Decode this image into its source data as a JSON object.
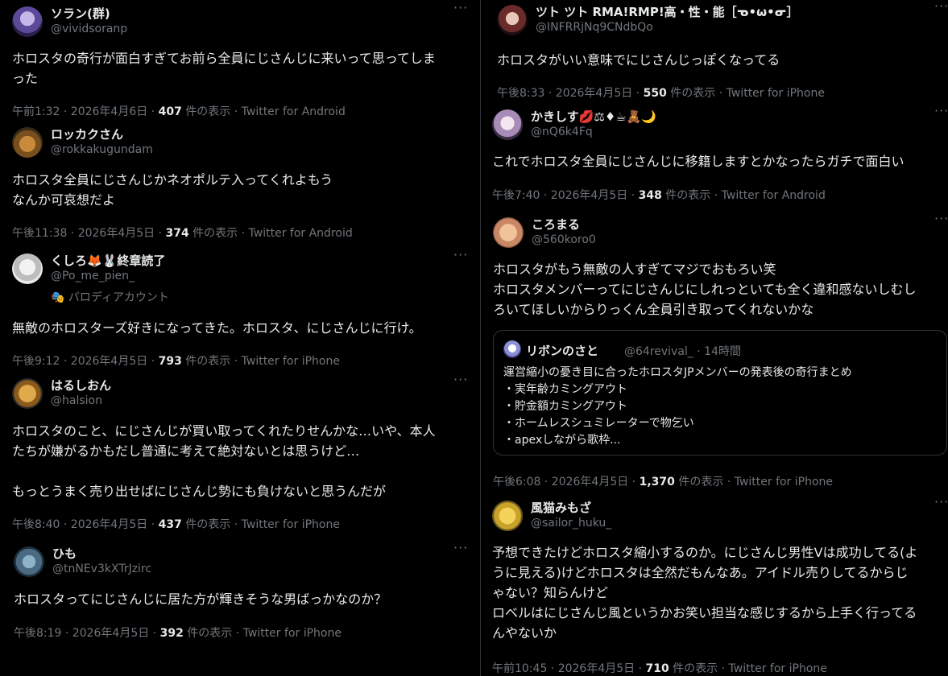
{
  "tweets": [
    {
      "name": "ソラン(群)",
      "handle": "@vividsoranp",
      "text": "ホロスタの奇行が面白すぎてお前ら全員にじさんじに来いって思ってしま\nった",
      "time": "午前1:32 · 2026年4月6日 · ",
      "views": "407",
      "views_suffix": " 件の表示 · Twitter for Android"
    },
    {
      "name": "ロッカクさん",
      "handle": "@rokkakugundam",
      "text": "ホロスタ全員にじさんじかネオポルテ入ってくれよもう\nなんか可哀想だよ",
      "time": "午後11:38 · 2026年4月5日 · ",
      "views": "374",
      "views_suffix": " 件の表示 · Twitter for Android"
    },
    {
      "name": "くしろ🦊🐰終章読了",
      "handle": "@Po_me_pien_",
      "parody": "🎭 パロディアカウント",
      "text": "無敵のホロスターズ好きになってきた。ホロスタ、にじさんじに行け。",
      "time": "午後9:12 · 2026年4月5日 · ",
      "views": "793",
      "views_suffix": " 件の表示 · Twitter for iPhone"
    },
    {
      "name": "はるしおん",
      "handle": "@halsion",
      "text": "ホロスタのこと、にじさんじが買い取ってくれたりせんかな…いや、本人\nたちが嫌がるかもだし普通に考えて絶対ないとは思うけど…\n\nもっとうまく売り出せばにじさんじ勢にも負けないと思うんだが",
      "time": "午後8:40 · 2026年4月5日 · ",
      "views": "437",
      "views_suffix": " 件の表示 · Twitter for iPhone"
    },
    {
      "name": "ひも",
      "handle": "@tnNEv3kXTrJzirc",
      "text": "ホロスタってにじさんじに居た方が輝きそうな男ばっかなのか？",
      "time": "午後8:19 · 2026年4月5日 · ",
      "views": "392",
      "views_suffix": " 件の表示 · Twitter for iPhone"
    },
    {
      "name": "ツト ツト RMA!RMP!高・性・能［ᓀ•ω•ᓂ］",
      "handle": "@INFRRjNq9CNdbQo",
      "text": "ホロスタがいい意味でにじさんじっぽくなってる",
      "time": "午後8:33 · 2026年4月5日 · ",
      "views": "550",
      "views_suffix": " 件の表示 · Twitter for iPhone"
    },
    {
      "name": "かきしす💋⚖♦☕🧸🌙",
      "handle": "@nQ6k4Fq",
      "text": "これでホロスタ全員にじさんじに移籍しますとかなったらガチで面白い",
      "time": "午後7:40 · 2026年4月5日 · ",
      "views": "348",
      "views_suffix": " 件の表示 · Twitter for Android"
    },
    {
      "name": "ころまる",
      "handle": "@560koro0",
      "text": "ホロスタがもう無敵の人すぎてマジでおもろい笑\nホロスタメンバーってにじさんじにしれっといても全く違和感ないしむし\nろいてほしいからりっくん全員引き取ってくれないかな",
      "time": "午後6:08 · 2026年4月5日 · ",
      "views": "1,370",
      "views_suffix": " 件の表示 · Twitter for iPhone",
      "quote": {
        "name": "リボンのさと",
        "handle": "@64revival_ · 14時間",
        "text": "運営縮小の憂き目に合ったホロスタJPメンバーの発表後の奇行まとめ\n・実年齢カミングアウト\n・貯金額カミングアウト\n・ホームレスシュミレーターで物乞い\n・apexしながら歌枠..."
      }
    },
    {
      "name": "風猫みもざ",
      "handle": "@sailor_huku_",
      "text": "予想できたけどホロスタ縮小するのか。にじさんじ男性Vは成功してる(よ\nうに見える)けどホロスタは全然だもんなあ。アイドル売りしてるからじ\nゃない？知らんけど\nロベルはにじさんじ風というかお笑い担当な感じするから上手く行ってる\nんやないか",
      "time": "午前10:45 · 2026年4月5日 · ",
      "views": "710",
      "views_suffix": " 件の表示 · Twitter for iPhone"
    }
  ],
  "more_glyph": "···"
}
